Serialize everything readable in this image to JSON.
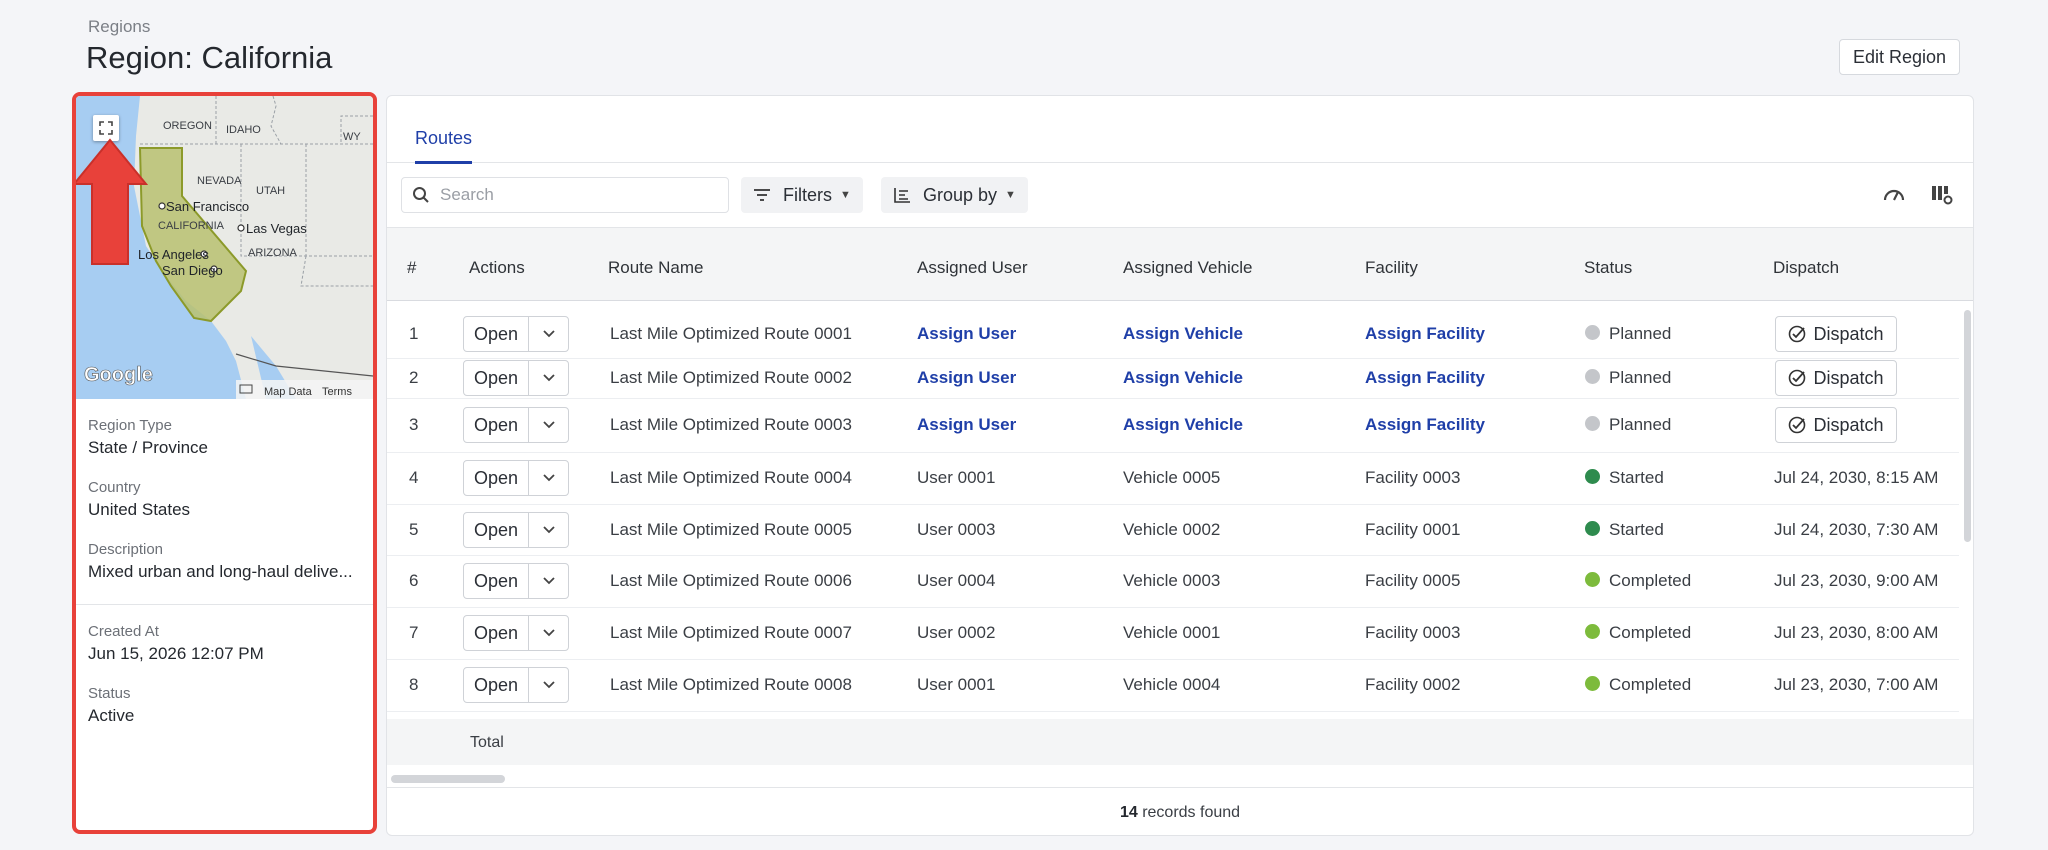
{
  "header": {
    "breadcrumb": "Regions",
    "title": "Region: California",
    "edit_button": "Edit Region"
  },
  "region": {
    "map_labels": {
      "oregon": "OREGON",
      "idaho": "IDAHO",
      "wy": "WY",
      "nevada": "NEVADA",
      "utah": "UTAH",
      "san_francisco": "San Francisco",
      "california": "CALIFORNIA",
      "las_vegas": "Las Vegas",
      "arizona": "ARIZONA",
      "los_angeles": "Los Angeles",
      "san_diego": "San Diego",
      "google": "Google",
      "map_data": "Map Data",
      "terms": "Terms"
    },
    "fields": {
      "region_type_label": "Region Type",
      "region_type": "State / Province",
      "country_label": "Country",
      "country": "United States",
      "description_label": "Description",
      "description": "Mixed urban and long-haul delive...",
      "created_label": "Created At",
      "created": "Jun 15, 2026 12:07 PM",
      "status_label": "Status",
      "status": "Active"
    }
  },
  "tabs": {
    "routes": "Routes"
  },
  "toolbar": {
    "search_placeholder": "Search",
    "filters": "Filters",
    "group_by": "Group by"
  },
  "table": {
    "columns": {
      "num": "#",
      "actions": "Actions",
      "route": "Route Name",
      "user": "Assigned User",
      "vehicle": "Assigned Vehicle",
      "facility": "Facility",
      "status": "Status",
      "dispatch": "Dispatch"
    },
    "open_label": "Open",
    "dispatch_label": "Dispatch",
    "rows": [
      {
        "num": "1",
        "route": "Last Mile Optimized Route 0001",
        "user": "Assign User",
        "vehicle": "Assign Vehicle",
        "facility": "Assign Facility",
        "status": "Planned"
      },
      {
        "num": "2",
        "route": "Last Mile Optimized Route 0002",
        "user": "Assign User",
        "vehicle": "Assign Vehicle",
        "facility": "Assign Facility",
        "status": "Planned"
      },
      {
        "num": "3",
        "route": "Last Mile Optimized Route 0003",
        "user": "Assign User",
        "vehicle": "Assign Vehicle",
        "facility": "Assign Facility",
        "status": "Planned"
      },
      {
        "num": "4",
        "route": "Last Mile Optimized Route 0004",
        "user": "User 0001",
        "vehicle": "Vehicle 0005",
        "facility": "Facility 0003",
        "status": "Started",
        "dispatch": "Jul 24, 2030, 8:15 AM"
      },
      {
        "num": "5",
        "route": "Last Mile Optimized Route 0005",
        "user": "User 0003",
        "vehicle": "Vehicle 0002",
        "facility": "Facility 0001",
        "status": "Started",
        "dispatch": "Jul 24, 2030, 7:30 AM"
      },
      {
        "num": "6",
        "route": "Last Mile Optimized Route 0006",
        "user": "User 0004",
        "vehicle": "Vehicle 0003",
        "facility": "Facility 0005",
        "status": "Completed",
        "dispatch": "Jul 23, 2030, 9:00 AM"
      },
      {
        "num": "7",
        "route": "Last Mile Optimized Route 0007",
        "user": "User 0002",
        "vehicle": "Vehicle 0001",
        "facility": "Facility 0003",
        "status": "Completed",
        "dispatch": "Jul 23, 2030, 8:00 AM"
      },
      {
        "num": "8",
        "route": "Last Mile Optimized Route 0008",
        "user": "User 0001",
        "vehicle": "Vehicle 0004",
        "facility": "Facility 0002",
        "status": "Completed",
        "dispatch": "Jul 23, 2030, 7:00 AM"
      }
    ],
    "total_label": "Total",
    "records_count": "14",
    "records_suffix": "records found"
  },
  "colors": {
    "accent": "#1f3fa8",
    "highlight": "#e8413a",
    "planned": "#c4c6ca",
    "started": "#2e8b4e",
    "completed": "#7dbb3c"
  }
}
